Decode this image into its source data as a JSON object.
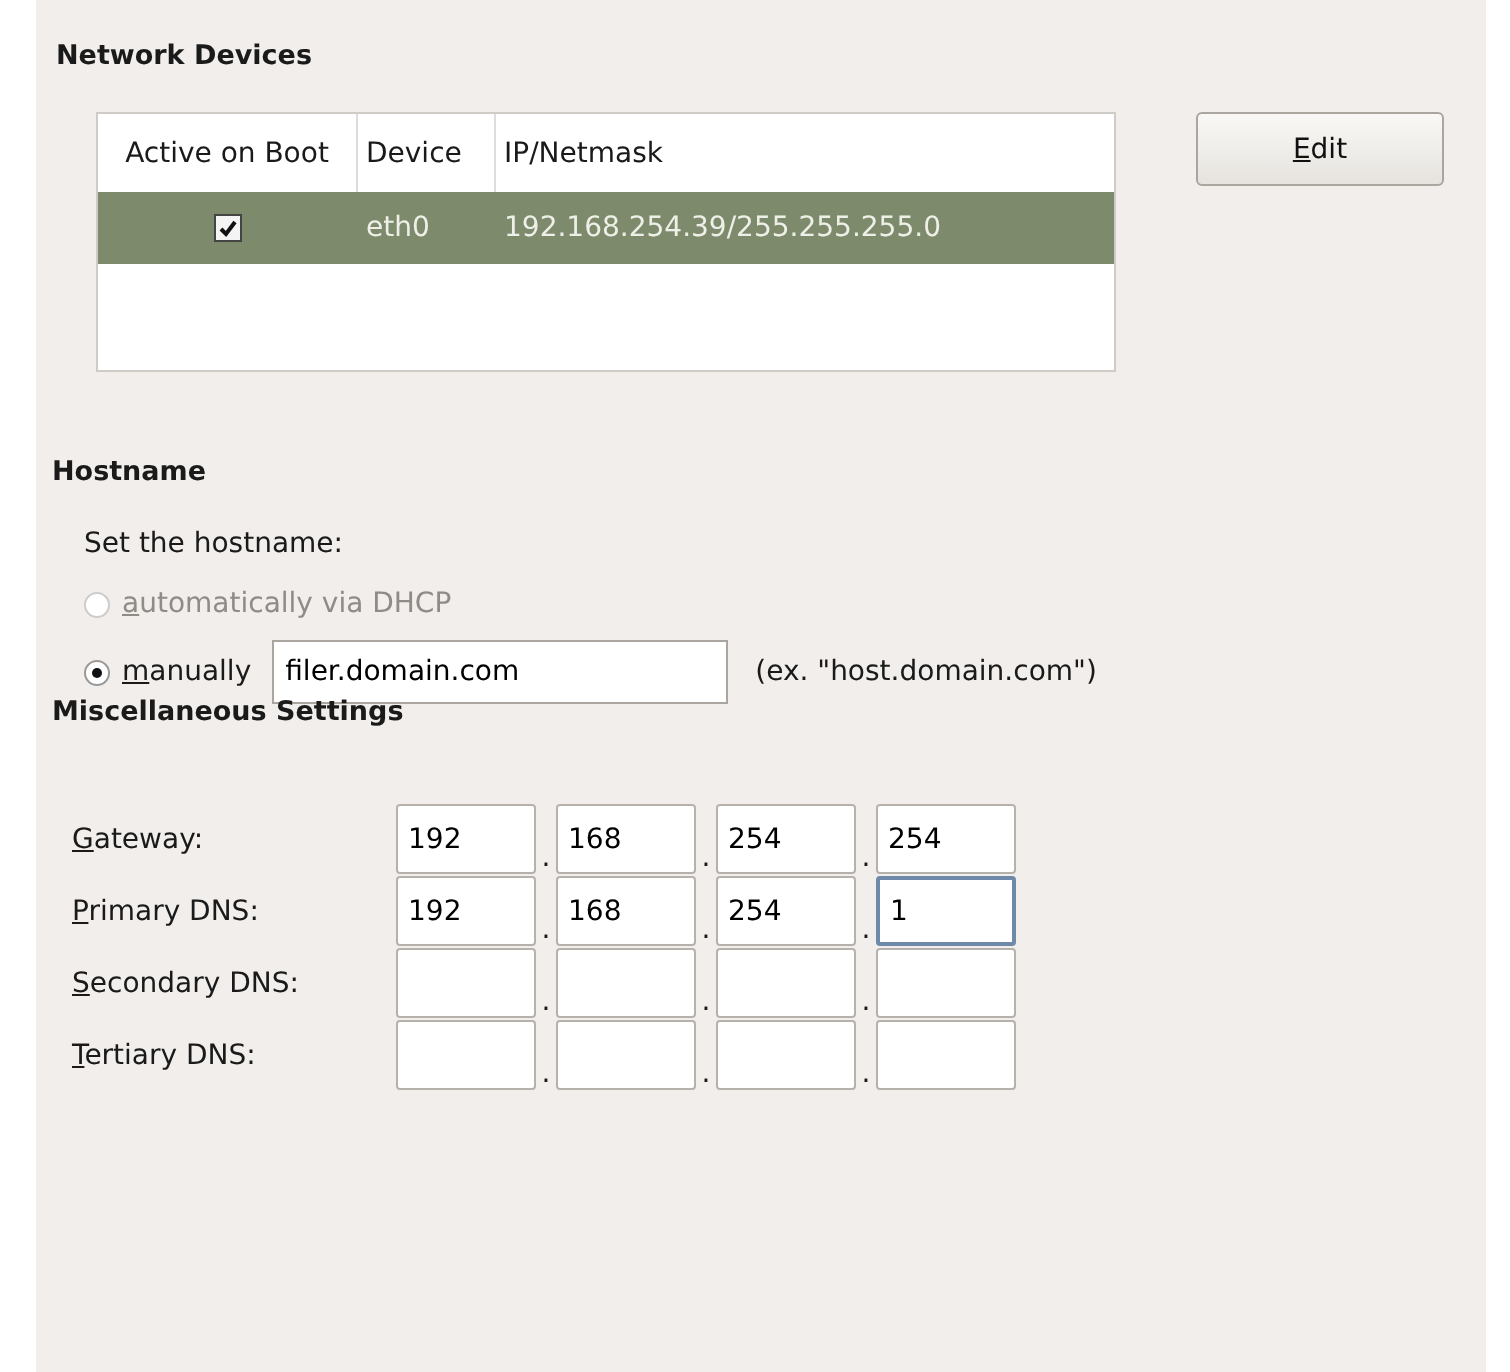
{
  "network_devices": {
    "title": "Network Devices",
    "table": {
      "columns": [
        "Active on Boot",
        "Device",
        "IP/Netmask"
      ],
      "rows": [
        {
          "active_on_boot": true,
          "device": "eth0",
          "ip_netmask": "192.168.254.39/255.255.255.0",
          "selected": true
        }
      ]
    },
    "edit_button": {
      "label": "Edit",
      "mnemonic": true
    }
  },
  "hostname": {
    "title": "Hostname",
    "prompt": "Set the hostname:",
    "options": [
      {
        "label": "automatically via DHCP",
        "mnemonic": true,
        "selected": false,
        "disabled": true
      },
      {
        "label": "manually",
        "mnemonic": true,
        "selected": true,
        "disabled": false
      }
    ],
    "field": {
      "value": "filer.domain.com"
    },
    "hint": "(ex. \"host.domain.com\")"
  },
  "misc": {
    "title": "Miscellaneous Settings",
    "rows": [
      {
        "label": "Gateway:",
        "mnemonic": true,
        "octets": [
          {
            "value": "192",
            "focused": false
          },
          {
            "separator": ".",
            "value": "168",
            "focused": false
          },
          {
            "separator": ".",
            "value": "254",
            "focused": false
          },
          {
            "separator": ".",
            "value": "254",
            "focused": false
          }
        ]
      },
      {
        "label": "Primary DNS:",
        "mnemonic": true,
        "octets": [
          {
            "value": "192",
            "focused": false
          },
          {
            "separator": ".",
            "value": "168",
            "focused": false
          },
          {
            "separator": ".",
            "value": "254",
            "focused": false
          },
          {
            "separator": ".",
            "value": "1",
            "focused": true
          }
        ]
      },
      {
        "label": "Secondary DNS:",
        "mnemonic": true,
        "octets": [
          {
            "focused": false
          },
          {
            "separator": ".",
            "focused": false
          },
          {
            "separator": ".",
            "focused": false
          },
          {
            "separator": ".",
            "focused": false
          }
        ]
      },
      {
        "label": "Tertiary DNS:",
        "mnemonic": true,
        "octets": [
          {
            "focused": false
          },
          {
            "separator": ".",
            "focused": false
          },
          {
            "separator": ".",
            "focused": false
          },
          {
            "separator": ".",
            "focused": false
          }
        ]
      }
    ]
  }
}
